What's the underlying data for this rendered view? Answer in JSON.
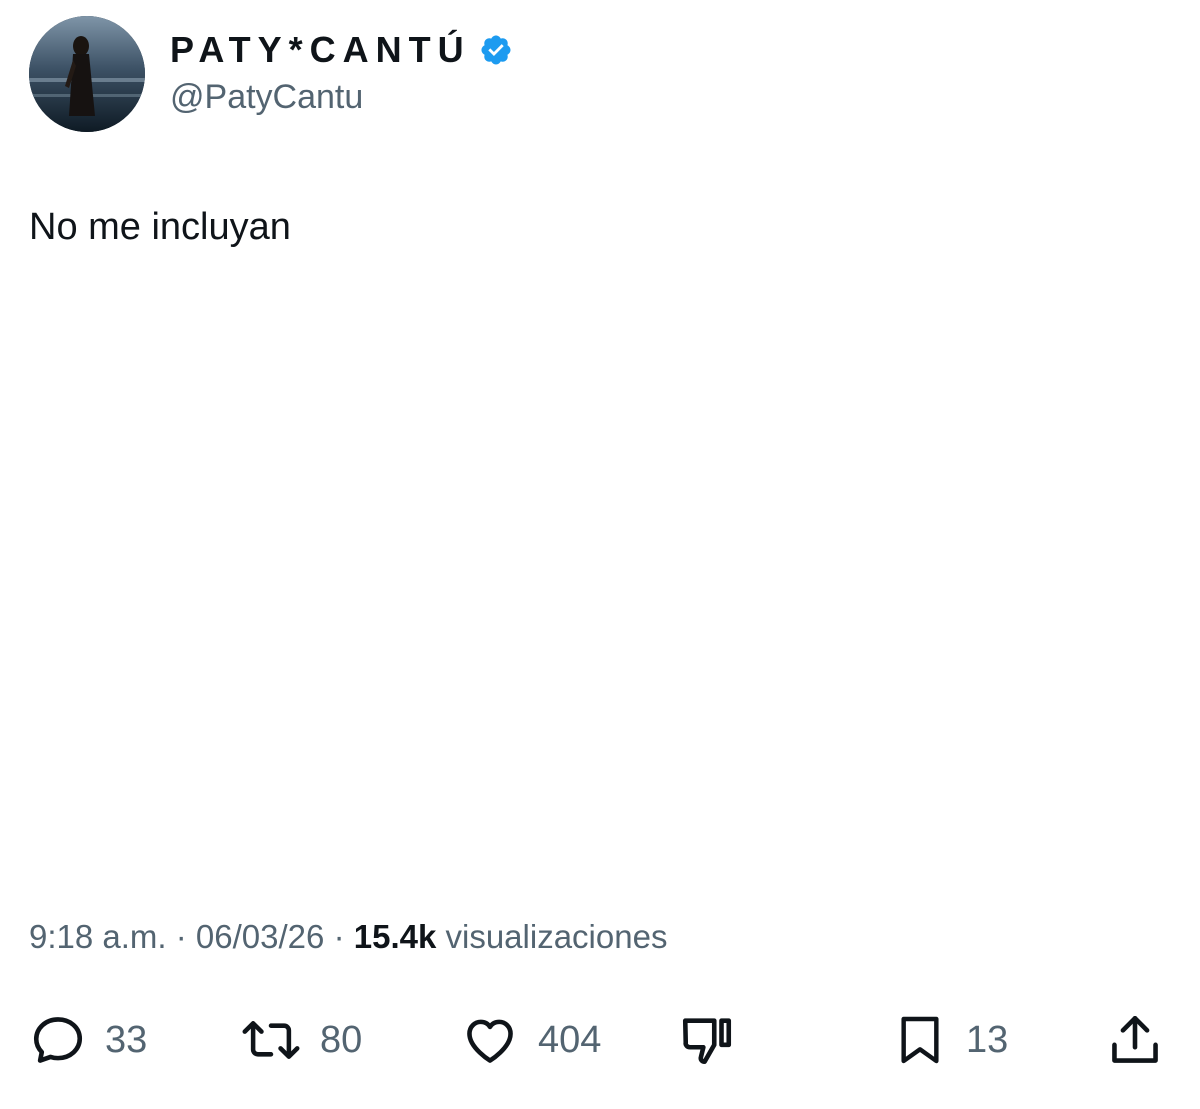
{
  "tweet": {
    "display_name": "PATY*CANTÚ",
    "handle": "@PatyCantu",
    "text": "No me incluyan",
    "time": "9:18 a.m.",
    "date": "06/03/26",
    "separator": "·",
    "views_count": "15.4k",
    "views_label": "visualizaciones"
  },
  "actions": {
    "replies": "33",
    "reposts": "80",
    "likes": "404",
    "bookmarks": "13"
  },
  "colors": {
    "text_primary": "#0f1419",
    "text_secondary": "#536471",
    "verified": "#1d9bf0"
  },
  "icons": [
    "reply-icon",
    "repost-icon",
    "like-icon",
    "dislike-icon",
    "bookmark-icon",
    "share-icon",
    "verified-badge-icon"
  ]
}
